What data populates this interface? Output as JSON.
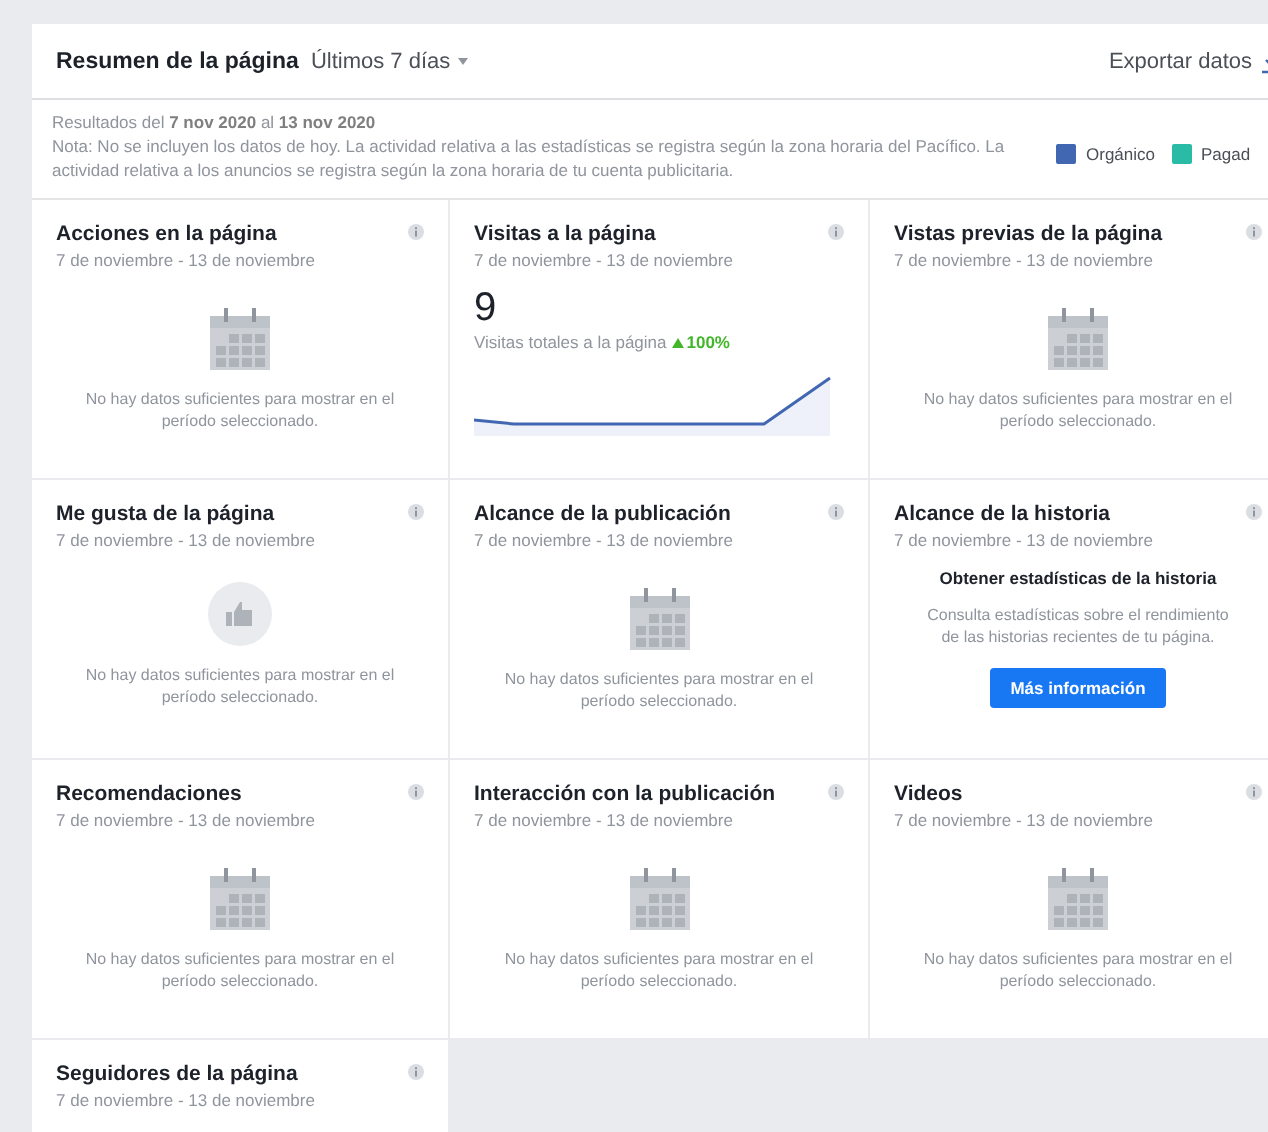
{
  "header": {
    "title": "Resumen de la página",
    "range": "Últimos 7 días",
    "export": "Exportar datos"
  },
  "info": {
    "results": "Resultados del **7 nov 2020** al **13 nov 2020**",
    "note": "Nota: No se incluyen los datos de hoy. La actividad relativa a las estadísticas se registra según la zona horaria del Pacífico. La actividad relativa a los anuncios se registra según la zona horaria de tu cuenta publicitaria.",
    "legend": [
      {
        "label": "Orgánico",
        "color": "#4267b2"
      },
      {
        "label": "Pagad",
        "color": "#2abba7"
      }
    ]
  },
  "cards": [
    {
      "kind": "empty",
      "title": "Acciones en la página",
      "dates": "7 de noviembre - 13 de noviembre",
      "message": "No hay datos suficientes para mostrar en el período seleccionado."
    },
    {
      "kind": "metric",
      "title": "Visitas a la página",
      "dates": "7 de noviembre - 13 de noviembre",
      "value": "9",
      "caption": "Visitas totales a la página",
      "change": "100%"
    },
    {
      "kind": "empty",
      "title": "Vistas previas de la página",
      "dates": "7 de noviembre - 13 de noviembre",
      "message": "No hay datos suficientes para mostrar en el período seleccionado."
    },
    {
      "kind": "likes",
      "title": "Me gusta de la página",
      "dates": "7 de noviembre - 13 de noviembre",
      "message": "No hay datos suficientes para mostrar en el período seleccionado."
    },
    {
      "kind": "empty",
      "title": "Alcance de la publicación",
      "dates": "7 de noviembre - 13 de noviembre",
      "message": "No hay datos suficientes para mostrar en el período seleccionado."
    },
    {
      "kind": "story",
      "title": "Alcance de la historia",
      "dates": "7 de noviembre - 13 de noviembre",
      "heading": "Obtener estadísticas de la historia",
      "text": "Consulta estadísticas sobre el rendimiento de las historias recientes de tu página.",
      "button": "Más información"
    },
    {
      "kind": "empty",
      "title": "Recomendaciones",
      "dates": "7 de noviembre - 13 de noviembre",
      "message": "No hay datos suficientes para mostrar en el período seleccionado."
    },
    {
      "kind": "empty",
      "title": "Interacción con la publicación",
      "dates": "7 de noviembre - 13 de noviembre",
      "message": "No hay datos suficientes para mostrar en el período seleccionado."
    },
    {
      "kind": "empty",
      "title": "Videos",
      "dates": "7 de noviembre - 13 de noviembre",
      "message": "No hay datos suficientes para mostrar en el período seleccionado."
    },
    {
      "kind": "cut",
      "title": "Seguidores de la página",
      "dates": "7 de noviembre - 13 de noviembre"
    }
  ]
}
